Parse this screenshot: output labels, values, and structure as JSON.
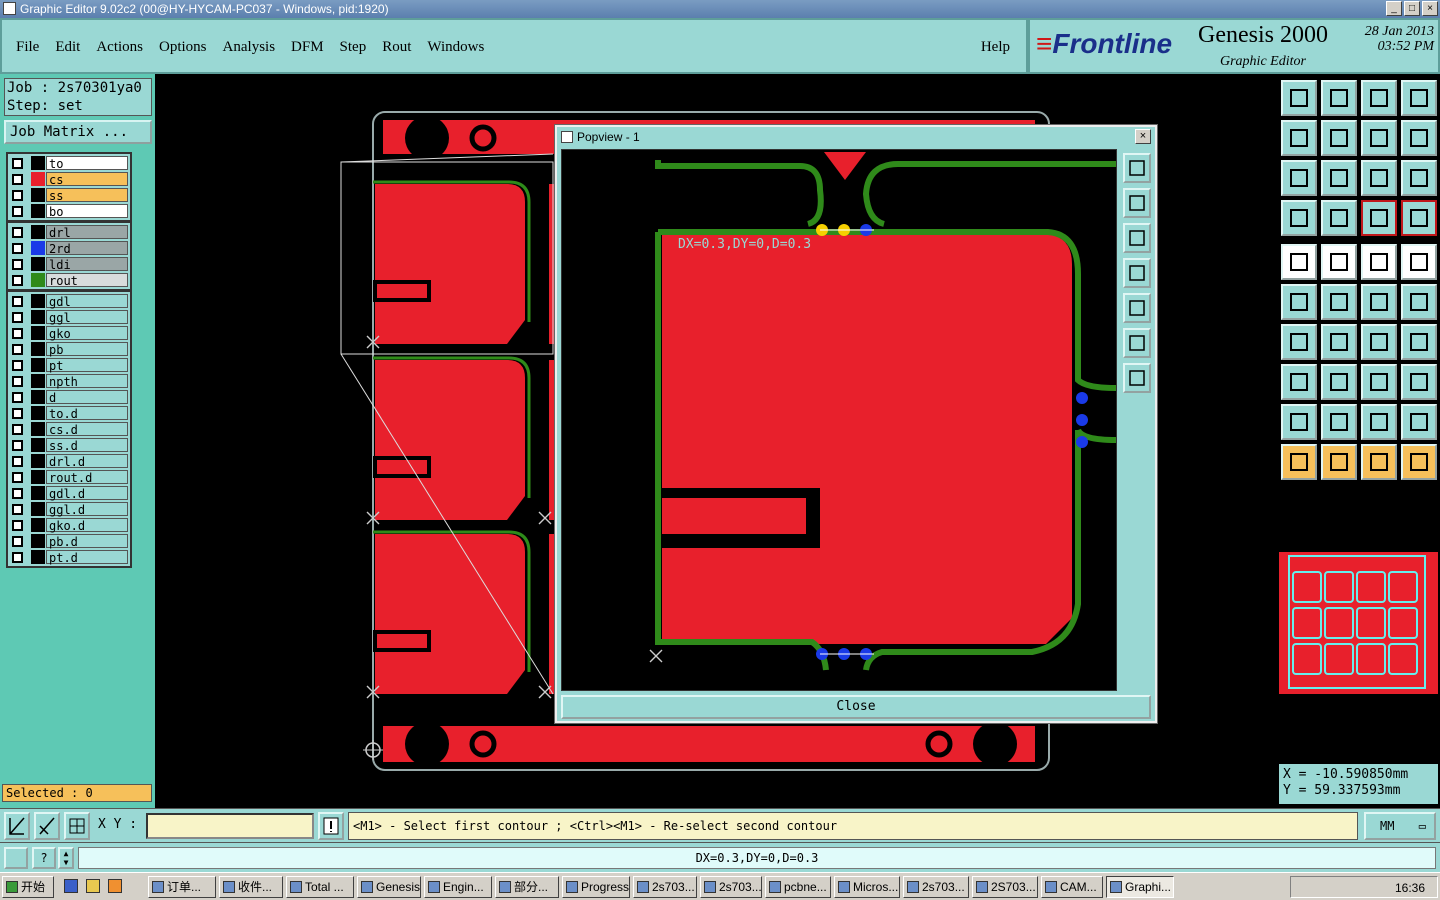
{
  "window": {
    "title": "Graphic Editor 9.02c2 (00@HY-HYCAM-PC037 - Windows, pid:1920)"
  },
  "menu": {
    "items": [
      "File",
      "Edit",
      "Actions",
      "Options",
      "Analysis",
      "DFM",
      "Step",
      "Rout",
      "Windows"
    ],
    "help": "Help"
  },
  "branding": {
    "company": "Frontline",
    "product": "Genesis 2000",
    "subtitle": "Graphic Editor",
    "date": "28 Jan 2013",
    "time": "03:52 PM"
  },
  "job": {
    "job_line": "Job : 2s70301ya0",
    "step_line": "Step: set",
    "matrix_button": "Job Matrix ..."
  },
  "layers": {
    "group1": [
      {
        "name": "to",
        "swatch": "#000000",
        "bg": "#ffffff"
      },
      {
        "name": "cs",
        "swatch": "#e8202c",
        "bg": "#f6c05a"
      },
      {
        "name": "ss",
        "swatch": "#000000",
        "bg": "#f6c05a"
      },
      {
        "name": "bo",
        "swatch": "#000000",
        "bg": "#ffffff"
      }
    ],
    "group2": [
      {
        "name": "drl",
        "swatch": "#000000",
        "bg": "#9aa6a6"
      },
      {
        "name": "2rd",
        "swatch": "#1a3ae8",
        "bg": "#9aa6a6"
      },
      {
        "name": "ldi",
        "swatch": "#000000",
        "bg": "#9aa6a6"
      },
      {
        "name": "rout",
        "swatch": "#2f8a1a",
        "bg": "#d8dcdc"
      }
    ],
    "group3": [
      {
        "name": "gdl"
      },
      {
        "name": "ggl"
      },
      {
        "name": "gko"
      },
      {
        "name": "pb"
      },
      {
        "name": "pt"
      },
      {
        "name": "npth"
      },
      {
        "name": "d"
      },
      {
        "name": "to.d"
      },
      {
        "name": "cs.d"
      },
      {
        "name": "ss.d"
      },
      {
        "name": "drl.d"
      },
      {
        "name": "rout.d"
      },
      {
        "name": "gdl.d"
      },
      {
        "name": "ggl.d"
      },
      {
        "name": "gko.d"
      },
      {
        "name": "pb.d"
      },
      {
        "name": "pt.d"
      }
    ]
  },
  "selected_label": "Selected : 0",
  "popview": {
    "title": "Popview - 1",
    "measure_text": "DX=0.3,DY=0,D=0.3",
    "close_label": "Close"
  },
  "coords": {
    "x_line": "X = -10.590850mm",
    "y_line": "Y = 59.337593mm"
  },
  "command": {
    "xy_label": "X Y :",
    "xy_value": "",
    "prompt": "<M1> - Select first contour ; <Ctrl><M1> - Re-select second contour",
    "units": "MM"
  },
  "status_message": "DX=0.3,DY=0,D=0.3",
  "taskbar": {
    "start": "开始",
    "tasks": [
      "订单...",
      "收件...",
      "Total ...",
      "Genesis",
      "Engin...",
      "部分...",
      "Progress",
      "2s703...",
      "2s703...",
      "pcbne...",
      "Micros...",
      "2s703...",
      "2S703...",
      "CAM...",
      "Graphi..."
    ],
    "active_index": 14,
    "clock": "16:36"
  },
  "colors": {
    "panel": "#9ad8d4",
    "copper": "#e8202c",
    "rout": "#2f8a1a",
    "drill": "#1a3ae8",
    "highlight": "#f6d000"
  }
}
